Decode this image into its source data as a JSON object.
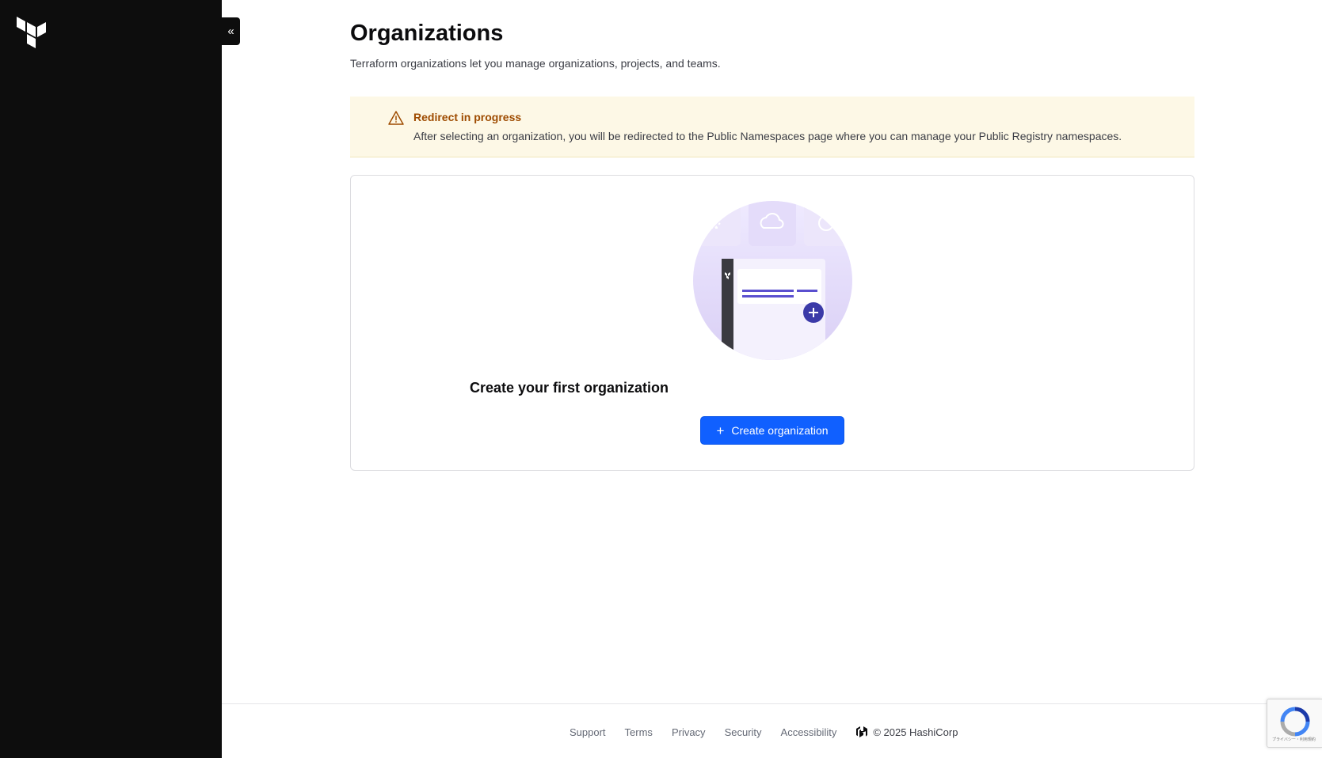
{
  "sidebar": {
    "logo_icon": "terraform-logo-icon",
    "collapse_label": "«"
  },
  "page": {
    "title": "Organizations",
    "description": "Terraform organizations let you manage organizations, projects, and teams."
  },
  "alert": {
    "icon": "warning-triangle-icon",
    "title": "Redirect in progress",
    "description": "After selecting an organization, you will be redirected to the Public Namespaces page where you can manage your Public Registry namespaces."
  },
  "empty_state": {
    "title": "Create your first organization",
    "button_label": "Create organization",
    "button_icon": "plus-icon"
  },
  "footer": {
    "links": [
      "Support",
      "Terms",
      "Privacy",
      "Security",
      "Accessibility"
    ],
    "copyright": "© 2025 HashiCorp"
  },
  "recaptcha": {
    "text": "プライバシー・利用規約"
  },
  "colors": {
    "sidebar_bg": "#0d0d0d",
    "primary": "#1060ff",
    "alert_bg": "#fdf8e6",
    "alert_title": "#9e4b00",
    "illustration_accent": "#5a4fcf"
  }
}
